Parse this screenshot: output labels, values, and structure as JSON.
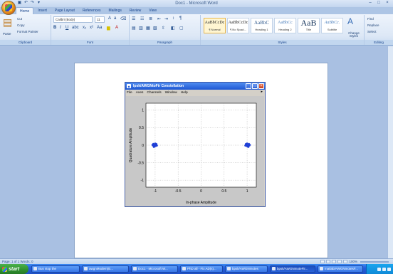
{
  "app": {
    "window_title": "Doc1 - Microsoft Word",
    "quick_access": [
      "save-icon",
      "undo-icon",
      "redo-icon",
      "customize-icon"
    ],
    "window_controls": [
      "–",
      "□",
      "×"
    ]
  },
  "ribbon": {
    "tabs": [
      "Home",
      "Insert",
      "Page Layout",
      "References",
      "Mailings",
      "Review",
      "View"
    ],
    "active_tab": "Home",
    "clipboard": {
      "label": "Clipboard",
      "paste": "Paste",
      "cut": "Cut",
      "copy": "Copy",
      "format_painter": "Format Painter"
    },
    "font": {
      "label": "Font",
      "name": "Calibri (Body)",
      "size": "11"
    },
    "paragraph": {
      "label": "Paragraph"
    },
    "styles": {
      "label": "Styles",
      "items": [
        {
          "sample": "AaBbCcDc",
          "name": "¶ Normal"
        },
        {
          "sample": "AaBbCcDc",
          "name": "¶ No Spaci..."
        },
        {
          "sample": "AaBbC",
          "name": "Heading 1"
        },
        {
          "sample": "AaBbCc",
          "name": "Heading 2"
        },
        {
          "sample": "AaB",
          "name": "Title"
        },
        {
          "sample": "AaBbCc.",
          "name": "Subtitle"
        }
      ],
      "change_styles": "Change Styles"
    },
    "editing": {
      "label": "Editing",
      "find": "Find",
      "replace": "Replace",
      "select": "Select"
    }
  },
  "figure": {
    "title": "Ipsk/AWGNtoFir Constellation",
    "menu": [
      "File",
      "Axes",
      "Channels",
      "Window",
      "Help"
    ],
    "xlabel": "In-phase Amplitude",
    "ylabel": "Quadrature Amplitude",
    "x_ticks": [
      "-1",
      "-0.5",
      "0",
      "0.5",
      "1"
    ],
    "y_ticks": [
      "1",
      "0.5",
      "0",
      "-0.5",
      "-1"
    ]
  },
  "chart_data": {
    "type": "scatter",
    "title": "",
    "xlabel": "In-phase Amplitude",
    "ylabel": "Quadrature Amplitude",
    "xlim": [
      -1.2,
      1.2
    ],
    "ylim": [
      -1.2,
      1.2
    ],
    "grid": true,
    "series": [
      {
        "values": [
          [
            -1.0,
            0.0
          ],
          [
            -1.03,
            0.02
          ],
          [
            -0.98,
            -0.02
          ],
          [
            -1.05,
            -0.01
          ],
          [
            -0.97,
            0.03
          ],
          [
            -1.01,
            -0.04
          ],
          [
            -1.04,
            0.04
          ],
          [
            -0.99,
            0.01
          ],
          [
            -1.02,
            -0.03
          ],
          [
            -0.96,
            -0.01
          ],
          [
            -1.06,
            0.01
          ],
          [
            -1.0,
            0.05
          ],
          [
            -1.03,
            -0.05
          ],
          [
            -0.98,
            0.04
          ],
          [
            -1.01,
            0.0
          ],
          [
            1.0,
            0.0
          ],
          [
            1.03,
            0.02
          ],
          [
            0.98,
            -0.02
          ],
          [
            1.05,
            -0.01
          ],
          [
            0.97,
            0.03
          ],
          [
            1.01,
            -0.04
          ],
          [
            1.04,
            0.04
          ],
          [
            0.99,
            0.01
          ],
          [
            1.02,
            -0.03
          ],
          [
            0.96,
            -0.01
          ],
          [
            1.06,
            0.01
          ],
          [
            1.0,
            0.05
          ],
          [
            1.03,
            -0.05
          ],
          [
            0.98,
            0.04
          ],
          [
            1.01,
            0.0
          ]
        ],
        "color": "#1f3fd6"
      }
    ]
  },
  "statusbar": {
    "left": "Page: 1 of 1   Words: 0",
    "zoom": "100%"
  },
  "taskbar": {
    "start": "start",
    "tasks": [
      "Bus stop the",
      "awgnModem(E...",
      "Doc1 - Microsoft W...",
      "PhD all - Fix AD(s)...",
      "bpsk/AWGNmotes",
      "bpsk/AWGNmoteFir...",
      "matlab/AWGNmotesF..."
    ],
    "active_task": 5
  }
}
